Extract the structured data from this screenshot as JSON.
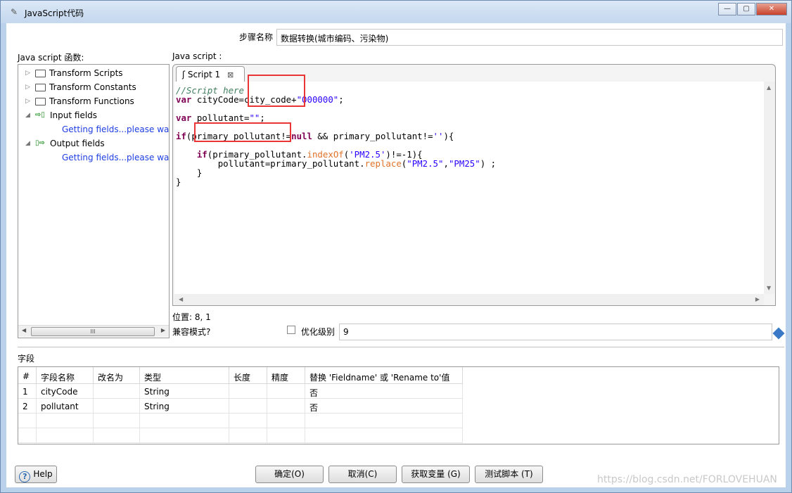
{
  "window": {
    "title": "JavaScript代码"
  },
  "step": {
    "label": "步骤名称",
    "value": "数据转换(城市编码、污染物)"
  },
  "functions_panel": {
    "label": "Java script 函数:",
    "items": [
      {
        "label": "Transform Scripts"
      },
      {
        "label": "Transform Constants"
      },
      {
        "label": "Transform Functions"
      },
      {
        "label": "Input fields"
      },
      {
        "label": "Getting fields...please wait"
      },
      {
        "label": "Output fields"
      },
      {
        "label": "Getting fields...please wait"
      }
    ],
    "scroll_thumb": "III"
  },
  "editor": {
    "label": "Java script :",
    "tab_label": "Script 1",
    "code": {
      "l1": "//Script here",
      "l2_kw": "var",
      "l2a": " cityCode=city_code+",
      "l2s": "\"000000\"",
      "l2e": ";",
      "l3_kw": "var",
      "l3a": " pollutant=",
      "l3s": "\"\"",
      "l3e": ";",
      "l4_kw1": "if",
      "l4a": "(primary_pollutant!=",
      "l4_kw2": "null",
      "l4b": " && primary_pollutant!=",
      "l4s": "''",
      "l4e": "){",
      "l5_kw": "if",
      "l5a": "(primary_pollutant.",
      "l5f": "indexOf",
      "l5b": "(",
      "l5s": "'PM2.5'",
      "l5c": ")!=-1){",
      "l6a": "pollutant=primary_pollutant.",
      "l6f": "replace",
      "l6b": "(",
      "l6s1": "\"PM2.5\"",
      "l6c": ",",
      "l6s2": "\"PM25\"",
      "l6d": ") ;",
      "l7": "}",
      "l8": "}"
    }
  },
  "position": {
    "label": "位置: 8, 1"
  },
  "compat": {
    "label": "兼容模式?"
  },
  "optimize": {
    "label": "优化级别",
    "value": "9",
    "checked": false
  },
  "fields": {
    "label": "字段",
    "columns": [
      "#",
      "字段名称",
      "改名为",
      "类型",
      "长度",
      "精度",
      "替换 'Fieldname' 或 'Rename to'值"
    ],
    "rows": [
      [
        "1",
        "cityCode",
        "",
        "String",
        "",
        "",
        "否"
      ],
      [
        "2",
        "pollutant",
        "",
        "String",
        "",
        "",
        "否"
      ]
    ]
  },
  "buttons": {
    "help": "Help",
    "ok": "确定(O)",
    "cancel": "取消(C)",
    "get_vars": "获取变量 (G)",
    "test": "测试脚本 (T)"
  },
  "watermark": "https://blog.csdn.net/FORLOVEHUAN",
  "colors": {
    "highlight_box": "#e83535",
    "keyword": "#7f0055",
    "link": "#1e3ee3"
  }
}
